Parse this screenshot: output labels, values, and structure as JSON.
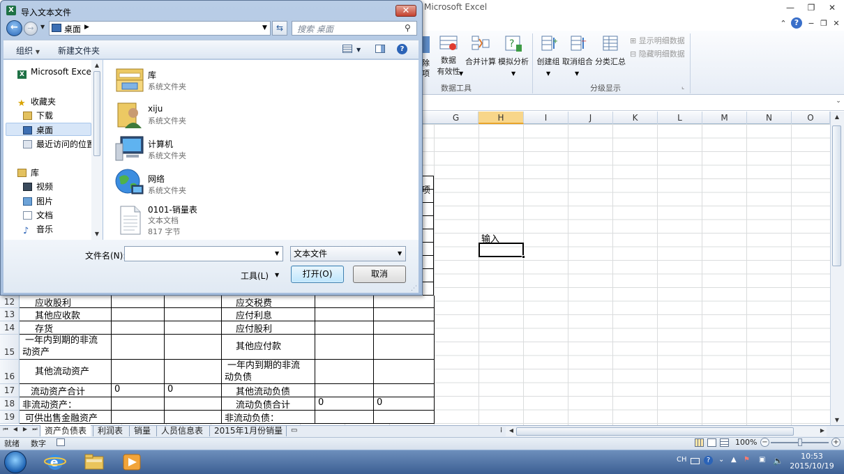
{
  "excel": {
    "title": "Microsoft Excel",
    "ribbon": {
      "btn_remove_label": "除",
      "btn_remove_label2": "项",
      "data_validation": [
        "数据",
        "有效性"
      ],
      "consolidate": "合并计算",
      "what_if": "模拟分析",
      "group": "创建组",
      "ungroup": "取消组合",
      "subtotal": "分类汇总",
      "show_detail": "显示明细数据",
      "hide_detail": "隐藏明细数据",
      "group_data_tools": "数据工具",
      "group_outline": "分级显示"
    },
    "columns": [
      "G",
      "H",
      "I",
      "J",
      "K",
      "L",
      "M",
      "N",
      "O"
    ],
    "selected_column": "H",
    "input_cell_label": "输入",
    "rows": [
      {
        "num": "12",
        "a": "应收股利",
        "d": "应交税费"
      },
      {
        "num": "13",
        "a": "其他应收款",
        "d": "应付利息"
      },
      {
        "num": "14",
        "a": "存货",
        "d": "应付股利"
      },
      {
        "num": "15",
        "a": "一年内到期的非流动资产",
        "d": "其他应付款"
      },
      {
        "num": "16",
        "a": "其他流动资产",
        "d": "一年内到期的非流动负债"
      },
      {
        "num": "17",
        "a": "流动资产合计",
        "b": "0",
        "c": "0",
        "d": "其他流动负债"
      },
      {
        "num": "18",
        "a": "非流动资产：",
        "d": "流动负债合计",
        "e": "0",
        "f": "0"
      },
      {
        "num": "19",
        "a": "可供出售金融资产",
        "d": "非流动负债："
      }
    ],
    "row15_a_lines": [
      "一年内到期的非流",
      "动资产"
    ],
    "row16_d_lines": [
      "一年内到期的非流",
      "动负债"
    ],
    "sheet_tabs": [
      "资产负债表",
      "利润表",
      "销量",
      "人员信息表",
      "2015年1月份销量"
    ],
    "active_sheet": "资产负债表",
    "status": {
      "ready": "就绪",
      "mode": "数字",
      "zoom": "100%"
    },
    "taskbar": {
      "lang": "CH",
      "time": "10:53",
      "date": "2015/10/19"
    }
  },
  "dialog": {
    "title": "导入文本文件",
    "address": "桌面",
    "search_placeholder": "搜索 桌面",
    "toolbar": {
      "organize": "组织",
      "new_folder": "新建文件夹"
    },
    "nav": {
      "app": "Microsoft Excel",
      "favorites": "收藏夹",
      "downloads": "下载",
      "desktop": "桌面",
      "recent": "最近访问的位置",
      "libraries": "库",
      "videos": "视频",
      "pictures": "图片",
      "documents": "文档",
      "music": "音乐"
    },
    "files": [
      {
        "name": "库",
        "type": "系统文件夹"
      },
      {
        "name": "xiju",
        "type": "系统文件夹"
      },
      {
        "name": "计算机",
        "type": "系统文件夹"
      },
      {
        "name": "网络",
        "type": "系统文件夹"
      },
      {
        "name": "0101-销量表",
        "type": "文本文档",
        "size": "817 字节"
      }
    ],
    "filename_label": "文件名(N):",
    "filename_value": "",
    "filetype": "文本文件",
    "tools_label": "工具(L)",
    "open_label": "打开(O)",
    "cancel_label": "取消"
  },
  "colors": {
    "accent": "#3c7fb1",
    "excel_green": "#1e7145",
    "selected_header": "#f8d68a"
  }
}
